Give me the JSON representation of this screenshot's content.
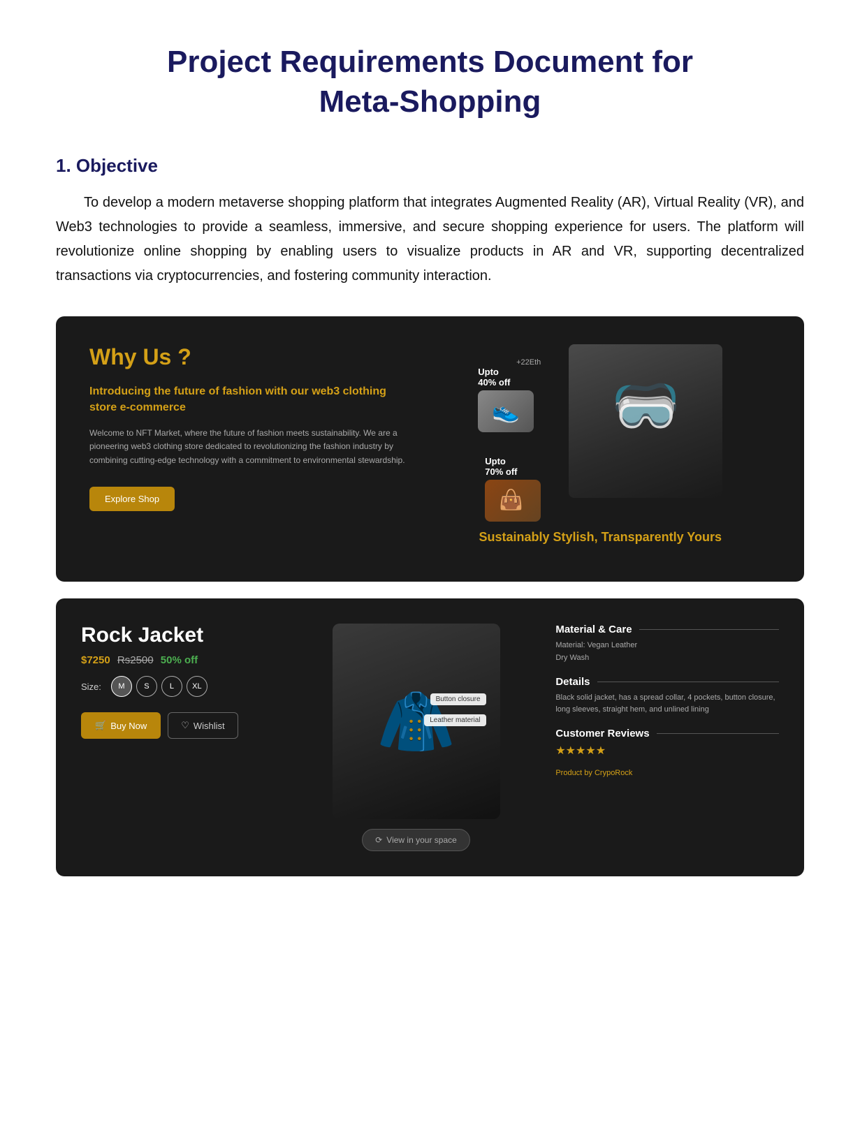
{
  "page": {
    "title_line1": "Project Requirements Document for",
    "title_line2": "Meta-Shopping"
  },
  "section1": {
    "heading": "1. Objective",
    "text": "To develop a modern metaverse shopping platform that integrates Augmented Reality (AR), Virtual Reality (VR), and Web3 technologies to provide a seamless, immersive, and secure shopping experience for users. The platform will revolutionize online shopping by enabling users to visualize products in AR and VR, supporting decentralized transactions via cryptocurrencies, and fostering community interaction."
  },
  "why_us_card": {
    "title": "Why ",
    "title_highlight": "Us",
    "title_suffix": " ?",
    "subtitle_prefix": "Introducing the ",
    "subtitle_highlight": "future of fashion",
    "subtitle_suffix": " with our web3 clothing store e-commerce",
    "body": "Welcome to NFT Market, where the future of fashion meets sustainability. We are a pioneering web3 clothing store dedicated to revolutionizing the fashion industry by combining cutting-edge technology with a commitment to environmental stewardship.",
    "explore_button": "Explore Shop",
    "discount_1_line1": "Upto",
    "discount_1_line2": "40% off",
    "discount_2_line1": "Upto",
    "discount_2_line2": "70% off",
    "eth_badge": "+22Eth",
    "tagline": "Sustainably Stylish, Transparently Yours"
  },
  "jacket_card": {
    "title": "Rock Jacket",
    "price_new": "$7250",
    "price_old": "Rs2500",
    "price_off": "50% off",
    "size_label": "Size:",
    "sizes": [
      "M",
      "S",
      "L",
      "XL"
    ],
    "buy_button": "Buy Now",
    "wishlist_button": "Wishlist",
    "tooltip_1": "Button closure",
    "tooltip_2": "Leather material",
    "ar_button": "View in your space",
    "material_title": "Material & Care",
    "material_body": "Material: Vegan Leather\nDry Wash",
    "details_title": "Details",
    "details_body": "Black solid jacket, has a spread collar, 4 pockets, button closure, long sleeves, straight hem, and unlined lining",
    "reviews_title": "Customer Reviews",
    "stars": "★★★★★",
    "crypto_prefix": "Product by ",
    "crypto_brand": "CrypoRock"
  }
}
